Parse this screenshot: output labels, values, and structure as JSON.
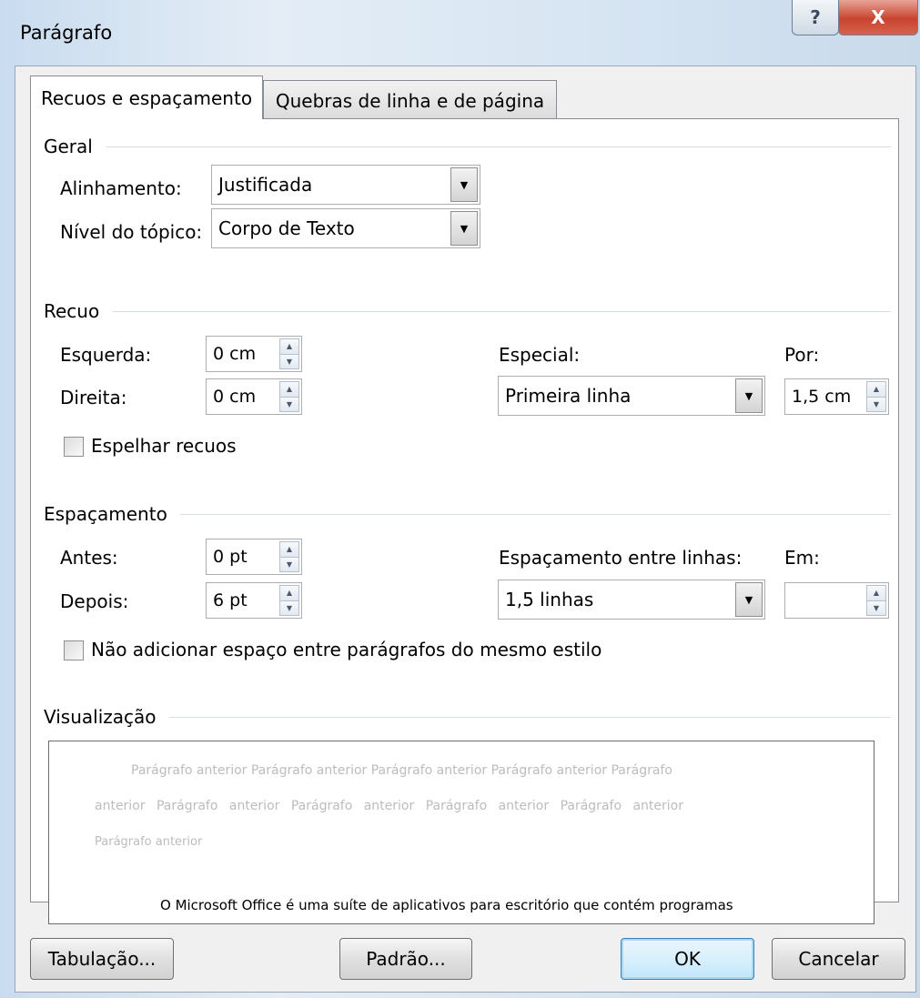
{
  "window": {
    "title": "Parágrafo",
    "help_label": "?",
    "close_label": "X"
  },
  "tabs": [
    {
      "label": "Recuos e espaçamento",
      "active": true
    },
    {
      "label": "Quebras de linha e de página",
      "active": false
    }
  ],
  "geral": {
    "section_label": "Geral",
    "alinhamento_label": "Alinhamento:",
    "alinhamento_value": "Justificada",
    "nivel_label": "Nível do tópico:",
    "nivel_value": "Corpo de Texto"
  },
  "recuo": {
    "section_label": "Recuo",
    "esquerda_label": "Esquerda:",
    "esquerda_value": "0 cm",
    "direita_label": "Direita:",
    "direita_value": "0 cm",
    "especial_label": "Especial:",
    "especial_value": "Primeira linha",
    "por_label": "Por:",
    "por_value": "1,5 cm",
    "espelhar_label": "Espelhar recuos",
    "espelhar_checked": false
  },
  "espacamento": {
    "section_label": "Espaçamento",
    "antes_label": "Antes:",
    "antes_value": "0 pt",
    "depois_label": "Depois:",
    "depois_value": "6 pt",
    "entre_linhas_label": "Espaçamento entre linhas:",
    "entre_linhas_value": "1,5 linhas",
    "em_label": "Em:",
    "em_value": "",
    "nao_adicionar_label": "Não adicionar espaço entre parágrafos do mesmo estilo",
    "nao_adicionar_checked": false
  },
  "visualizacao": {
    "section_label": "Visualização",
    "prev_line1": "Parágrafo anterior Parágrafo anterior Parágrafo anterior Parágrafo anterior Parágrafo",
    "prev_line2": "anterior Parágrafo anterior Parágrafo anterior Parágrafo anterior Parágrafo anterior",
    "prev_line3": "Parágrafo anterior",
    "sample_text": "O Microsoft Office é uma suíte de aplicativos para escritório que contém programas"
  },
  "buttons": {
    "tabulacao": "Tabulação...",
    "padrao": "Padrão...",
    "ok": "OK",
    "cancelar": "Cancelar"
  },
  "icons": {
    "dropdown": "▼",
    "spin_up": "▲",
    "spin_down": "▼"
  }
}
